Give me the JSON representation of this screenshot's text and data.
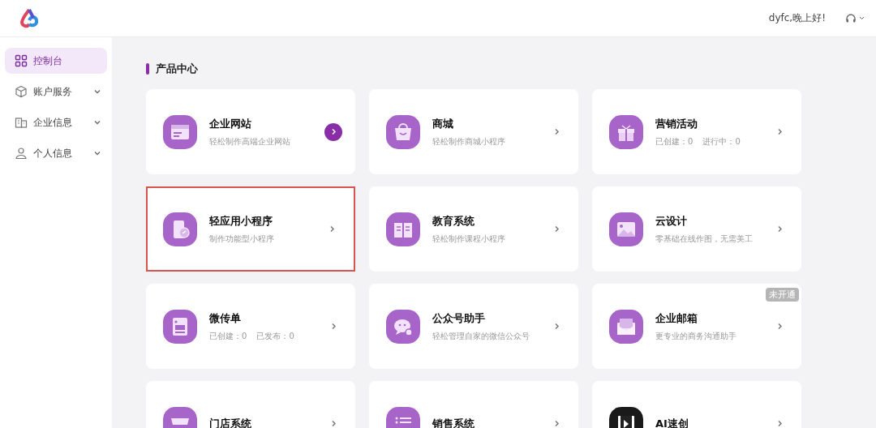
{
  "header": {
    "greeting": "dyfc,晚上好!"
  },
  "sidebar": {
    "items": [
      {
        "label": "控制台",
        "selected": true
      },
      {
        "label": "账户服务",
        "selected": false,
        "expanded": false
      },
      {
        "label": "企业信息",
        "selected": false,
        "expanded": false
      },
      {
        "label": "个人信息",
        "selected": false,
        "expanded": false
      }
    ]
  },
  "section": {
    "title": "产品中心"
  },
  "card_rows": [
    {
      "cards": [
        {
          "title": "企业网站",
          "subtitle": "轻松制作高端企业网站",
          "hovered": true,
          "highlighted": false
        },
        {
          "title": "商城",
          "subtitle": "轻松制作商城小程序",
          "hovered": false,
          "highlighted": false
        },
        {
          "title": "营销活动",
          "stats": [
            "已创建：0",
            "进行中：0"
          ],
          "hovered": false,
          "highlighted": false
        }
      ]
    },
    {
      "cards": [
        {
          "title": "轻应用小程序",
          "subtitle": "制作功能型小程序",
          "hovered": false,
          "highlighted": true
        },
        {
          "title": "教育系统",
          "subtitle": "轻松制作课程小程序",
          "hovered": false,
          "highlighted": false
        },
        {
          "title": "云设计",
          "subtitle": "零基础在线作图，无需美工",
          "hovered": false,
          "highlighted": false
        }
      ]
    },
    {
      "cards": [
        {
          "title": "微传单",
          "stats": [
            "已创建：0",
            "已发布：0"
          ],
          "hovered": false,
          "highlighted": false
        },
        {
          "title": "公众号助手",
          "subtitle": "轻松管理自家的微信公众号",
          "hovered": false,
          "highlighted": false
        },
        {
          "title": "企业邮箱",
          "subtitle": "更专业的商务沟通助手",
          "badge": "未开通",
          "hovered": false,
          "highlighted": false
        }
      ]
    },
    {
      "cards": [
        {
          "title": "门店系统",
          "hovered": false,
          "highlighted": false
        },
        {
          "title": "销售系统",
          "hovered": false,
          "highlighted": false
        },
        {
          "title": "AI速创",
          "hovered": false,
          "highlighted": false
        }
      ]
    }
  ]
}
